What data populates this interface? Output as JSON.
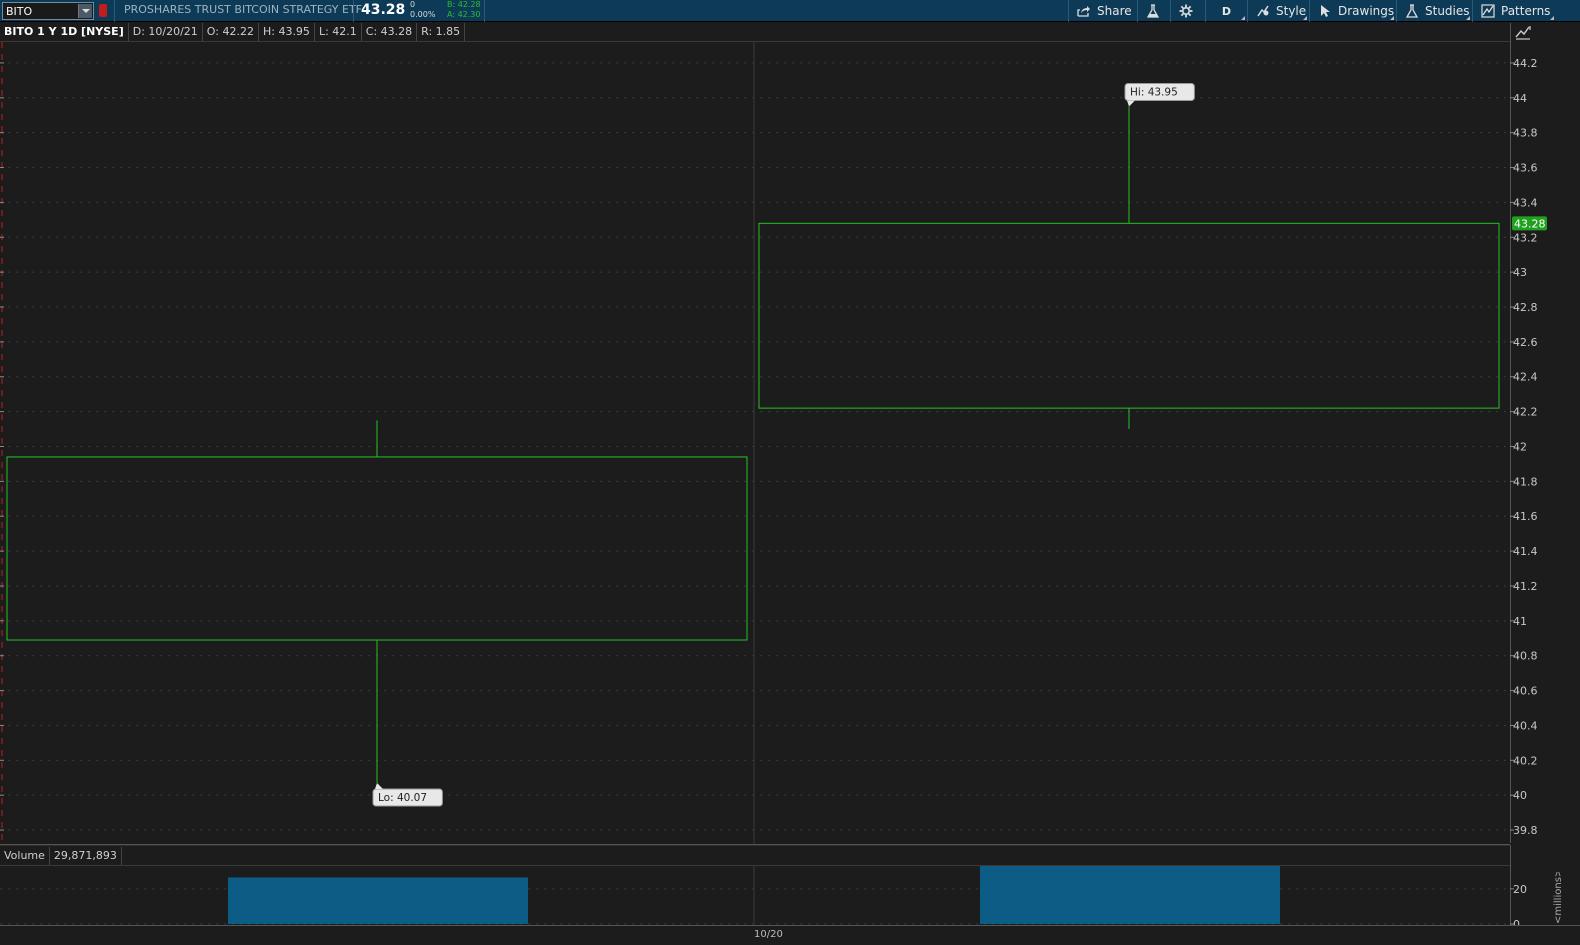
{
  "toolbar": {
    "symbol": "BITO",
    "description": "PROSHARES TRUST BITCOIN STRATEGY ETF",
    "last_price": "43.28",
    "net_change": "0",
    "pct_change": "0.00%",
    "bid": "B: 42.28",
    "ask": "A: 42.30",
    "buttons": {
      "share": "Share",
      "period": "D",
      "style": "Style",
      "drawings": "Drawings",
      "studies": "Studies",
      "patterns": "Patterns"
    },
    "icons": [
      "share-icon",
      "flask-icon",
      "gear-icon",
      "style-icon",
      "cursor-icon",
      "studies-icon",
      "patterns-icon"
    ]
  },
  "chart_header": {
    "title": "BITO 1 Y 1D [NYSE]",
    "date": "D: 10/20/21",
    "open": "O: 42.22",
    "high": "H: 43.95",
    "low": "L: 42.1",
    "close": "C: 43.28",
    "range": "R: 1.85"
  },
  "volume_header": {
    "label": "Volume",
    "value": "29,871,893",
    "unit": "<millions>"
  },
  "chart_data": [
    {
      "type": "candlestick",
      "title": "BITO 1 Y 1D [NYSE]",
      "y_ticks": [
        "39.8",
        "40",
        "40.2",
        "40.4",
        "40.6",
        "40.8",
        "41",
        "41.2",
        "41.4",
        "41.6",
        "41.8",
        "42",
        "42.2",
        "42.4",
        "42.6",
        "42.8",
        "43",
        "43.2",
        "43.4",
        "43.6",
        "43.8",
        "44",
        "44.2"
      ],
      "ylim": [
        39.72,
        44.32
      ],
      "x_ticks": [
        "10/20"
      ],
      "candles": [
        {
          "open": 41.94,
          "high": 42.15,
          "low": 40.07,
          "close": 40.89,
          "color": "#26c026"
        },
        {
          "open": 42.22,
          "high": 43.95,
          "low": 42.1,
          "close": 43.28,
          "color": "#26c026"
        }
      ],
      "annotations": [
        {
          "text": "Hi: 43.95"
        },
        {
          "text": "Lo: 40.07"
        }
      ],
      "last_price_badge": {
        "text": "43.28",
        "value": 43.28,
        "color": "#1fa11f"
      },
      "grid": true,
      "colors": {
        "up": "#26c026",
        "background": "#1c1c1c",
        "grid": "#3a3a3a"
      }
    },
    {
      "type": "bar",
      "title": "Volume",
      "unit": "millions",
      "values": [
        26.5,
        33.0
      ],
      "ylim": [
        0,
        33
      ],
      "y_ticks": [
        "0",
        "20"
      ],
      "colors": {
        "bar": "#0c5c86"
      }
    }
  ]
}
